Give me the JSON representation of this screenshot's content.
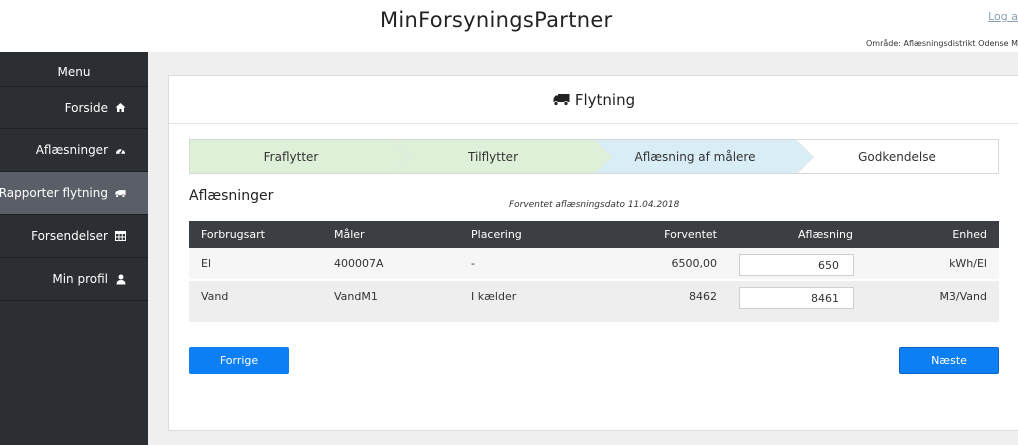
{
  "header": {
    "app_title": "MinForsyningsPartner",
    "logout_label": "Log a",
    "area_text": "Område: Aflæsningsdistrikt Odense M"
  },
  "sidebar": {
    "menu_title": "Menu",
    "items": [
      {
        "label": "Forside",
        "icon": "home-icon",
        "active": false
      },
      {
        "label": "Aflæsninger",
        "icon": "gauge-icon",
        "active": false
      },
      {
        "label": "Rapporter flytning",
        "icon": "truck-icon",
        "active": true
      },
      {
        "label": "Forsendelser",
        "icon": "table-icon",
        "active": false
      },
      {
        "label": "Min profil",
        "icon": "user-icon",
        "active": false
      }
    ]
  },
  "card": {
    "title": "Flytning",
    "title_icon": "truck-icon"
  },
  "steps": [
    {
      "label": "Fraflytter",
      "state": "done"
    },
    {
      "label": "Tilflytter",
      "state": "done"
    },
    {
      "label": "Aflæsning af målere",
      "state": "current"
    },
    {
      "label": "Godkendelse",
      "state": "todo"
    }
  ],
  "readings": {
    "title": "Aflæsninger",
    "expected_date_text": "Forventet aflæsningsdato 11.04.2018",
    "columns": [
      "Forbrugsart",
      "Måler",
      "Placering",
      "Forventet",
      "Aflæsning",
      "Enhed"
    ],
    "rows": [
      {
        "type": "El",
        "meter": "400007A",
        "location": "-",
        "expected": "6500,00",
        "reading": "650",
        "unit": "kWh/El"
      },
      {
        "type": "Vand",
        "meter": "VandM1",
        "location": "I kælder",
        "expected": "8462",
        "reading": "8461",
        "unit": "M3/Vand"
      }
    ]
  },
  "buttons": {
    "prev_label": "Forrige",
    "next_label": "Næste"
  },
  "colors": {
    "sidebar_bg": "#2b2e33",
    "sidebar_active": "#5a5e66",
    "step_done": "#dff0d8",
    "step_current": "#d9edf7",
    "table_header": "#3b3e42",
    "button_primary": "#0d7ff5"
  }
}
